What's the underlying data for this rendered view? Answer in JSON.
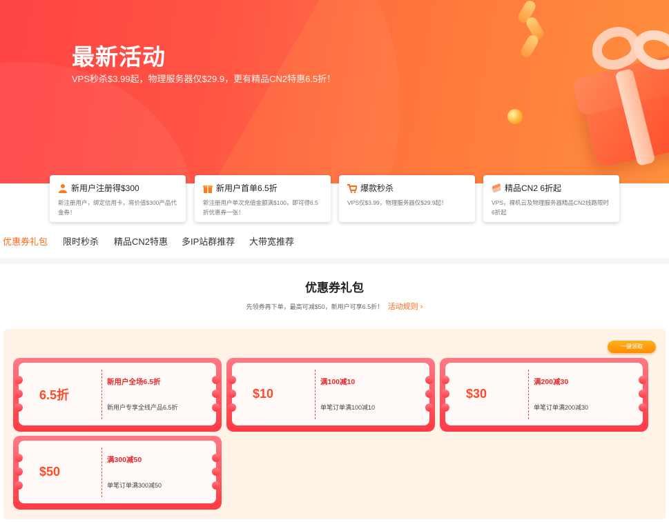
{
  "hero": {
    "title": "最新活动",
    "subtitle": "VPS秒杀$3.99起，物理服务器仅$29.9，更有精品CN2特惠6.5折！"
  },
  "feature_cards": [
    {
      "icon": "user-icon",
      "title": "新用户注册得$300",
      "desc": "新注册用户，绑定信用卡，将价值$300产品代金券！"
    },
    {
      "icon": "gift-icon",
      "title": "新用户首单6.5折",
      "desc": "新注册用户单次充值金额满$100，即可得6.5折优惠券一张！"
    },
    {
      "icon": "cart-icon",
      "title": "爆款秒杀",
      "desc": "VPS仅$3.99，物理服务器仅$29.9起！"
    },
    {
      "icon": "server-icon",
      "title": "精品CN2 6折起",
      "desc": "VPS，裸机云及物理服务器精品CN2线路限时6折起"
    }
  ],
  "tabs": [
    "优惠券礼包",
    "限时秒杀",
    "精品CN2特惠",
    "多IP站群推荐",
    "大带宽推荐"
  ],
  "active_tab": "优惠券礼包",
  "section": {
    "title": "优惠券礼包",
    "subtitle": "先领券再下单，最高可减$50，新用户可享6.5折！",
    "rules_link": "活动规则 ›",
    "claim_all": "一键领取"
  },
  "coupons": [
    {
      "amount": "6.5折",
      "name": "新用户全场6.5折",
      "desc": "新用户专享全线产品6.5折"
    },
    {
      "amount": "$10",
      "name": "满100减10",
      "desc": "单笔订单满100减10"
    },
    {
      "amount": "$30",
      "name": "满200减30",
      "desc": "单笔订单满200减30"
    },
    {
      "amount": "$50",
      "name": "满300减50",
      "desc": "单笔订单满300减50"
    }
  ],
  "colors": {
    "accent": "#ff6a1a",
    "coupon_red": "#ff3a44",
    "coupon_area_bg": "#fff2e6"
  }
}
